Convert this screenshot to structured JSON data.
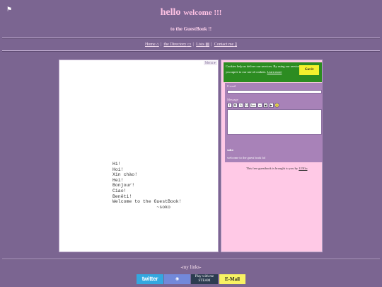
{
  "header": {
    "corner_icon": "flag-icon",
    "hello": "hello",
    "welcome": "welcome !!!",
    "subtitle": "to the GuestBook !!"
  },
  "nav": {
    "home": "Home",
    "directory": "the Directory",
    "lists": "Lists",
    "contact": "Contact me"
  },
  "left_panel": {
    "menu_label": "Menu ▸",
    "greeting": "Hi!\nHoi!\nXin chào!\nHei!\nBonjour!\nCiao!\nBenēti!\nWelcome to the GuestBook!\n                ~soko"
  },
  "cookie_banner": {
    "text": "Cookies help us deliver our services. By using our services, you agree to our use of cookies.",
    "learn_more": "Learn more",
    "button": "Got it"
  },
  "form": {
    "email_label": "E-mail",
    "message_label": "Message",
    "toolbar": [
      "I",
      "B",
      "A",
      "AA",
      "font",
      "",
      "",
      "",
      ""
    ]
  },
  "entry": {
    "name": "soko",
    "text": "welcome to the guest book lol"
  },
  "credit": {
    "text": "This free guestbook is brought to you by",
    "link": "123Gu"
  },
  "footer": {
    "links_label": "-my links-",
    "twitter": "twitter",
    "discord": "",
    "steam": "Play with me STEAM",
    "email": "E-Mail"
  },
  "colors": {
    "background": "#7b6591",
    "title": "#ffc2e4",
    "guestbook_panel": "#ffc9e6",
    "cookie_banner": "#2c8c21",
    "cookie_button": "#f3f02d"
  }
}
